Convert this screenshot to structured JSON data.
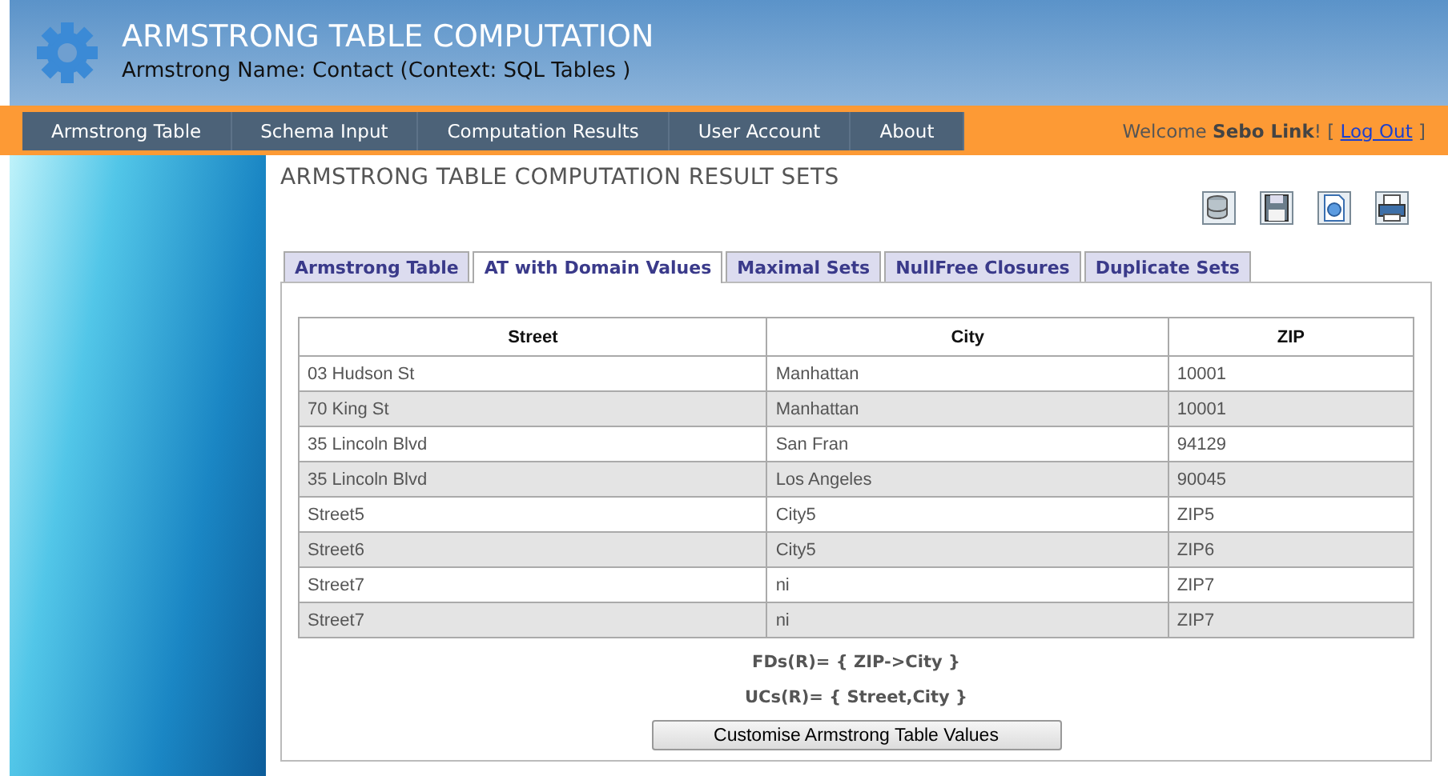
{
  "header": {
    "title": "ARMSTRONG TABLE COMPUTATION",
    "subtitle": "Armstrong Name: Contact (Context: SQL Tables )"
  },
  "nav": {
    "items": [
      {
        "label": "Armstrong Table"
      },
      {
        "label": "Schema Input"
      },
      {
        "label": "Computation Results"
      },
      {
        "label": "User Account"
      },
      {
        "label": "About"
      }
    ],
    "welcome": "Welcome **Sebo Link**! [",
    "logout": "Log Out",
    "welcome_end": "]"
  },
  "page_title": "ARMSTRONG TABLE COMPUTATION RESULT SETS",
  "toolbar": [
    {
      "kind": "database"
    },
    {
      "kind": "save"
    },
    {
      "kind": "document"
    },
    {
      "kind": "print"
    }
  ],
  "tabs": [
    {
      "label": "Armstrong Table",
      "selected": false
    },
    {
      "label": "AT with Domain Values",
      "selected": true
    },
    {
      "label": "Maximal Sets",
      "selected": false
    },
    {
      "label": "NullFree Closures",
      "selected": false
    },
    {
      "label": "Duplicate Sets",
      "selected": false
    }
  ],
  "table": {
    "columns": [
      "Street",
      "City",
      "ZIP"
    ],
    "rows": [
      [
        "03 Hudson St",
        "Manhattan",
        "10001"
      ],
      [
        "70 King St",
        "Manhattan",
        "10001"
      ],
      [
        "35 Lincoln Blvd",
        "San Fran",
        "94129"
      ],
      [
        "35 Lincoln Blvd",
        "Los Angeles",
        "90045"
      ],
      [
        "Street5",
        "City5",
        "ZIP5"
      ],
      [
        "Street6",
        "City5",
        "ZIP6"
      ],
      [
        "Street7",
        "ni",
        "ZIP7"
      ],
      [
        "Street7",
        "ni",
        "ZIP7"
      ]
    ]
  },
  "fds": "FDs(R)= { ZIP->City }",
  "ucs": "UCs(R)= { Street,City }",
  "button": "Customise Armstrong Table Values"
}
